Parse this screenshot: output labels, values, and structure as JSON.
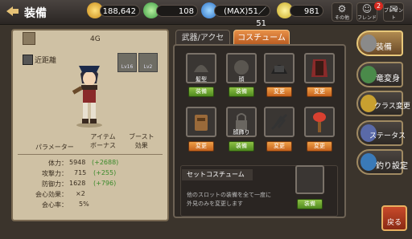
{
  "header": {
    "title": "装備"
  },
  "resources": {
    "gold": "188,642",
    "gem": "108",
    "stamina": "(MAX)51／51",
    "ticket": "981"
  },
  "topbuttons": {
    "others": "その他",
    "friend": "フレンド",
    "present": "プレゼント",
    "badge": "2"
  },
  "character": {
    "weight": "4G",
    "class": "近距離",
    "lv_a": "Lv16",
    "lv_b": "Lv2"
  },
  "stats_headers": {
    "param": "パラメーター",
    "item": "アイテム\nボーナス",
    "boost": "ブースト\n効果"
  },
  "stats": [
    {
      "label": "体力：",
      "value": "5948",
      "bonus": "(+2688)"
    },
    {
      "label": "攻撃力：",
      "value": "715",
      "bonus": "(+255)"
    },
    {
      "label": "防御力：",
      "value": "1628",
      "bonus": "(+796)"
    },
    {
      "label": "会心効果：",
      "value": "×2",
      "bonus": ""
    },
    {
      "label": "会心率：",
      "value": "5%",
      "bonus": ""
    }
  ],
  "tabs": {
    "weapon": "武器/アクセ",
    "costume": "コスチューム"
  },
  "slots": [
    {
      "label": "髪型",
      "button": "装備"
    },
    {
      "label": "顔",
      "button": "装備"
    },
    {
      "label": "",
      "button": "変更"
    },
    {
      "label": "",
      "button": "変更"
    },
    {
      "label": "",
      "button": "変更"
    },
    {
      "label": "顔飾り",
      "button": "装備"
    },
    {
      "label": "",
      "button": "変更"
    },
    {
      "label": "",
      "button": "変更"
    }
  ],
  "set_costume": {
    "title": "セットコスチューム",
    "desc": "他のスロットの装備を全て一度に\n外見のみを変更します",
    "button": "装備"
  },
  "side_menu": [
    "装備",
    "竜変身",
    "クラス変更",
    "ステータス",
    "釣り設定"
  ],
  "back_button": "戻る"
}
